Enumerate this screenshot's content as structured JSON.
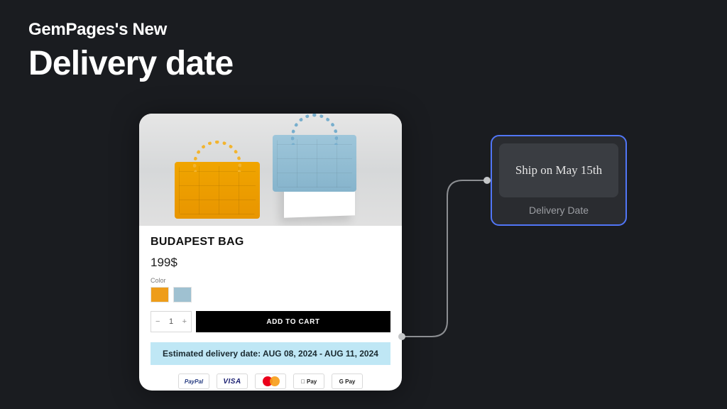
{
  "header": {
    "kicker": "GemPages's New",
    "title": "Delivery date"
  },
  "product": {
    "name": "BUDAPEST BAG",
    "price": "199$",
    "color_label": "Color",
    "swatches": [
      "orange",
      "lightblue"
    ],
    "quantity": {
      "minus": "−",
      "value": "1",
      "plus": "+"
    },
    "add_to_cart": "ADD TO CART",
    "delivery_banner": "Estimated delivery date: AUG 08, 2024 - AUG 11, 2024",
    "payment_badges": {
      "paypal": "PayPal",
      "visa": "VISA",
      "mastercard": "",
      "applepay": " Pay",
      "gpay": "G Pay"
    }
  },
  "widget": {
    "message": "Ship on May 15th",
    "label": "Delivery Date"
  },
  "colors": {
    "accent_banner": "#bfe7f5",
    "widget_border": "#5176f7"
  }
}
